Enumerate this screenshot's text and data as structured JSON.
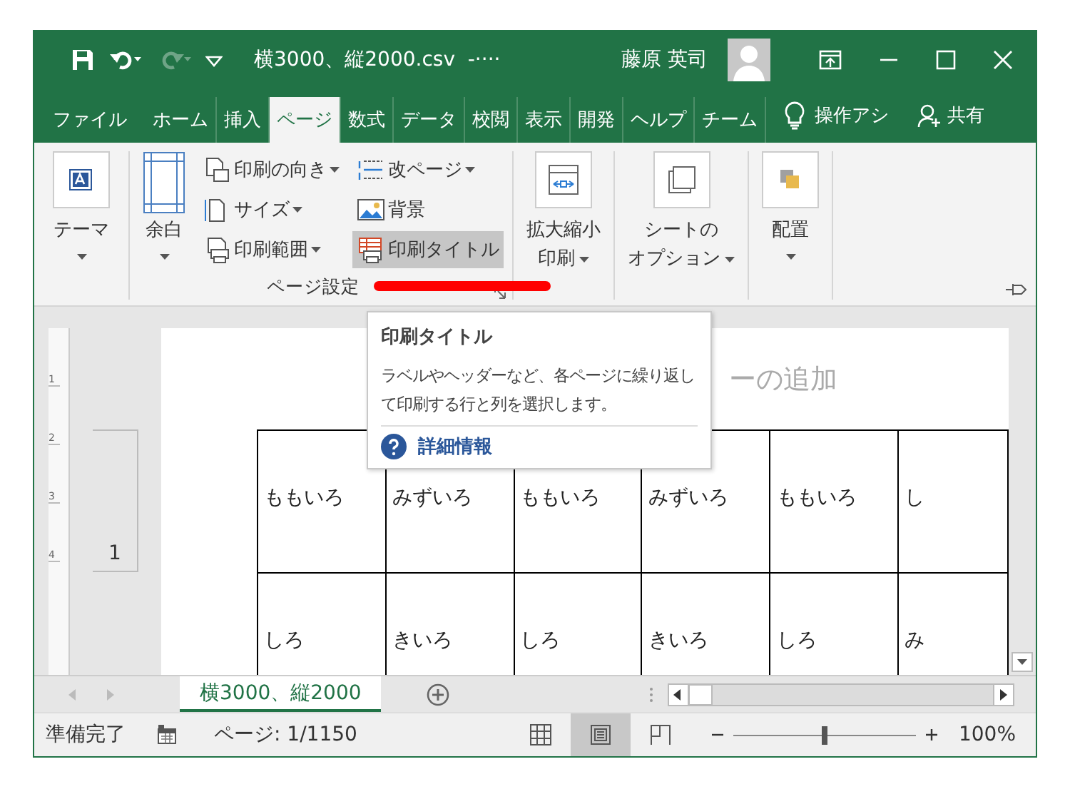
{
  "title_bar": {
    "quick_access": [
      {
        "disabled": false
      },
      {
        "disabled": false
      },
      {
        "disabled": true
      },
      {
        "disabled": false
      }
    ],
    "title": "横3000、縦2000.csv  -····",
    "user": "藤原 英司"
  },
  "ribbon_tabs": [
    {
      "label": "ファイル",
      "selected": false
    },
    {
      "label": "ホーム",
      "selected": false
    },
    {
      "label": "挿入",
      "selected": false
    },
    {
      "label": "ページ",
      "selected": true
    },
    {
      "label": "数式",
      "selected": false
    },
    {
      "label": "データ",
      "selected": false
    },
    {
      "label": "校閲",
      "selected": false
    },
    {
      "label": "表示",
      "selected": false
    },
    {
      "label": "開発",
      "selected": false
    },
    {
      "label": "ヘルプ",
      "selected": false
    },
    {
      "label": "チーム",
      "selected": false
    }
  ],
  "tell_me": "操作アシ",
  "share": "共有",
  "ribbon_groups": [
    {
      "items": [
        {
          "kind": "large",
          "lines": [
            "テーマ"
          ],
          "dropdown": true
        }
      ]
    },
    {
      "label": "ページ設定",
      "launcher": true,
      "items": [
        {
          "kind": "large",
          "lines": [
            "余白"
          ],
          "dropdown": true
        },
        {
          "kind": "column",
          "buttons": [
            {
              "label": "印刷の向き",
              "dropdown": true,
              "hovered": false
            },
            {
              "label": "サイズ",
              "dropdown": true,
              "hovered": false
            },
            {
              "label": "印刷範囲",
              "dropdown": true,
              "hovered": false
            }
          ]
        },
        {
          "kind": "column",
          "buttons": [
            {
              "label": "改ページ",
              "dropdown": true,
              "hovered": false
            },
            {
              "label": "背景",
              "dropdown": false,
              "hovered": false
            },
            {
              "label": "印刷タイトル",
              "dropdown": false,
              "hovered": true
            }
          ]
        }
      ]
    },
    {
      "items": [
        {
          "kind": "large",
          "lines": [
            "拡大縮小",
            "印刷"
          ],
          "dropdown": true
        }
      ]
    },
    {
      "items": [
        {
          "kind": "large",
          "lines": [
            "シートの",
            "オプション"
          ],
          "dropdown": true
        }
      ]
    },
    {
      "items": [
        {
          "kind": "large",
          "lines": [
            "配置"
          ],
          "dropdown": true
        }
      ]
    }
  ],
  "tooltip": {
    "title": "印刷タイトル",
    "body": "ラベルやヘッダーなど、各ページに繰り返して印刷する行と列を選択します。",
    "link": "詳細情報"
  },
  "sheet": {
    "ruler_marks": [
      "1",
      "2",
      "3",
      "4"
    ],
    "header_hint": "ーの追加",
    "row_header": "1",
    "rows": [
      [
        "ももいろ",
        "みずいろ",
        "ももいろ",
        "みずいろ",
        "ももいろ",
        "し"
      ],
      [
        "しろ",
        "きいろ",
        "しろ",
        "きいろ",
        "しろ",
        "み"
      ]
    ]
  },
  "sheet_tabs": [
    {
      "label": "横3000、縦2000",
      "selected": true
    }
  ],
  "status_bar": {
    "status": "準備完了",
    "page": "ページ: 1/1150",
    "views": [
      {
        "selected": false
      },
      {
        "selected": true
      },
      {
        "selected": false
      }
    ],
    "zoom": {
      "level": 0.5,
      "reading": "100%"
    }
  }
}
